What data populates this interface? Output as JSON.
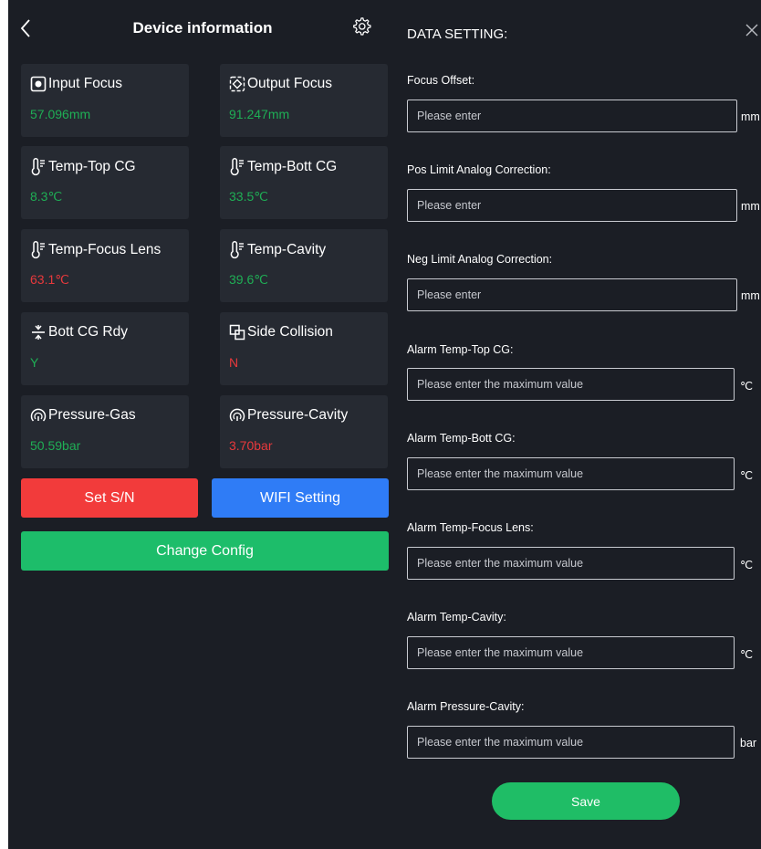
{
  "header": {
    "title": "Device information"
  },
  "cards": [
    {
      "label": "Input Focus",
      "value": "57.096mm",
      "icon": "focus-in-icon",
      "color": "green"
    },
    {
      "label": "Output Focus",
      "value": "91.247mm",
      "icon": "focus-out-icon",
      "color": "green"
    },
    {
      "label": "Temp-Top CG",
      "value": "8.3℃",
      "icon": "thermometer-icon",
      "color": "green"
    },
    {
      "label": "Temp-Bott CG",
      "value": "33.5℃",
      "icon": "thermometer-icon",
      "color": "green"
    },
    {
      "label": "Temp-Focus Lens",
      "value": "63.1℃",
      "icon": "thermometer-icon",
      "color": "red"
    },
    {
      "label": "Temp-Cavity",
      "value": "39.6℃",
      "icon": "thermometer-icon",
      "color": "green"
    },
    {
      "label": "Bott CG Rdy",
      "value": "Y",
      "icon": "divide-icon",
      "color": "green"
    },
    {
      "label": "Side Collision",
      "value": "N",
      "icon": "collision-icon",
      "color": "red"
    },
    {
      "label": "Pressure-Gas",
      "value": "50.59bar",
      "icon": "gauge-icon",
      "color": "green"
    },
    {
      "label": "Pressure-Cavity",
      "value": "3.70bar",
      "icon": "gauge-icon",
      "color": "red"
    }
  ],
  "buttons": {
    "set_sn": "Set S/N",
    "wifi": "WIFI Setting",
    "change_config": "Change Config"
  },
  "colors": {
    "background": "#1b1e25",
    "card": "#262a32",
    "green": "#1fae55",
    "red": "#e8393c",
    "set_sn_button": "#f23b3b",
    "wifi_button": "#2f7cf6",
    "change_config_button": "#1dbd6a"
  },
  "panel": {
    "title": "DATA SETTING:",
    "fields": [
      {
        "label": "Focus Offset:",
        "placeholder": "Please enter",
        "unit": "mm"
      },
      {
        "label": "Pos Limit Analog Correction:",
        "placeholder": "Please enter",
        "unit": "mm"
      },
      {
        "label": "Neg Limit Analog Correction:",
        "placeholder": "Please enter",
        "unit": "mm"
      },
      {
        "label": "Alarm Temp-Top CG:",
        "placeholder": "Please enter the maximum value",
        "unit": "℃"
      },
      {
        "label": "Alarm Temp-Bott CG:",
        "placeholder": "Please enter the maximum value",
        "unit": "℃"
      },
      {
        "label": "Alarm Temp-Focus Lens:",
        "placeholder": "Please enter the maximum value",
        "unit": "℃"
      },
      {
        "label": "Alarm Temp-Cavity:",
        "placeholder": "Please enter the maximum value",
        "unit": "℃"
      },
      {
        "label": "Alarm Pressure-Cavity:",
        "placeholder": "Please enter the maximum value",
        "unit": "bar"
      }
    ],
    "save": "Save"
  }
}
